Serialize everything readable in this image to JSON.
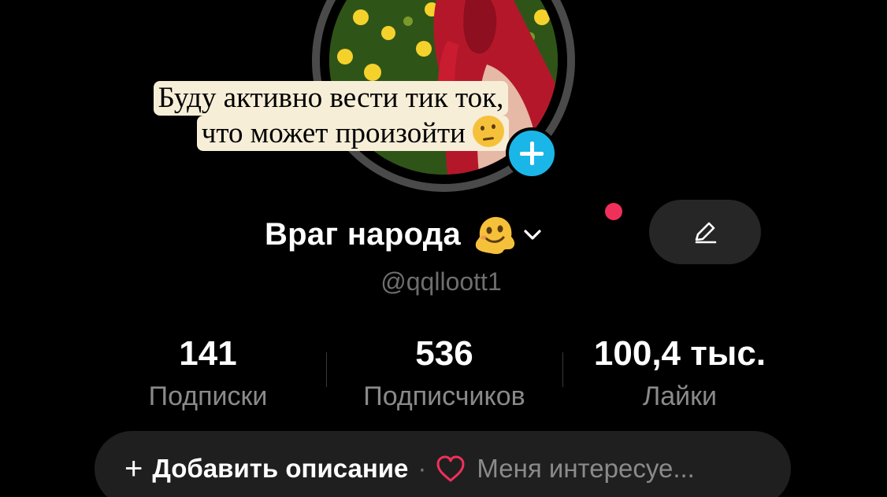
{
  "caption": {
    "line1": "Буду активно вести тик ток,",
    "line2": "что может произойти"
  },
  "profile": {
    "display_name": "Враг народа",
    "username": "@qqlloott1",
    "name_emoji_icon": "melting-face-icon",
    "caption_emoji_icon": "thinking-face-icon"
  },
  "stats": {
    "following_value": "141",
    "following_label": "Подписки",
    "followers_value": "536",
    "followers_label": "Подписчиков",
    "likes_value": "100,4 тыс.",
    "likes_label": "Лайки"
  },
  "bio": {
    "add_label": "Добавить описание",
    "separator": "·",
    "interests_label": "Меня интересуе..."
  },
  "colors": {
    "background": "#000000",
    "accent_blue": "#1ab6e8",
    "notification_red": "#f0305a",
    "heart_red": "#f0305a",
    "muted_text": "#8a8a8a"
  }
}
